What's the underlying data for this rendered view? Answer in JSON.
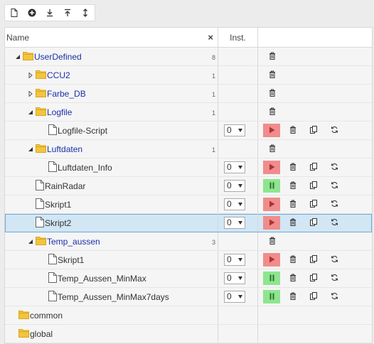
{
  "toolbar": {
    "buttons": [
      {
        "icon": "new-script-icon"
      },
      {
        "icon": "add-folder-icon"
      },
      {
        "icon": "import-icon"
      },
      {
        "icon": "export-icon"
      },
      {
        "icon": "sort-icon"
      }
    ]
  },
  "table": {
    "header_name": "Name",
    "header_clear": "×",
    "header_instance": "Inst."
  },
  "rows": [
    {
      "name": "UserDefined",
      "count": "8",
      "type": "folder",
      "level": 0,
      "expand": "expanded",
      "actions": "folder"
    },
    {
      "name": "CCU2",
      "count": "1",
      "type": "folder",
      "level": 1,
      "expand": "collapsed",
      "actions": "folder"
    },
    {
      "name": "Farbe_DB",
      "count": "1",
      "type": "folder",
      "level": 1,
      "expand": "collapsed",
      "actions": "folder"
    },
    {
      "name": "Logfile",
      "count": "1",
      "type": "folder",
      "level": 1,
      "expand": "expanded",
      "actions": "folder"
    },
    {
      "name": "Logfile-Script",
      "type": "script",
      "level": 2,
      "instance": "0",
      "state": "stopped",
      "actions": "script"
    },
    {
      "name": "Luftdaten",
      "count": "1",
      "type": "folder",
      "level": 1,
      "expand": "expanded",
      "actions": "folder"
    },
    {
      "name": "Luftdaten_Info",
      "type": "script",
      "level": 2,
      "instance": "0",
      "state": "stopped",
      "actions": "script"
    },
    {
      "name": "RainRadar",
      "type": "script",
      "level": 1,
      "instance": "0",
      "state": "running",
      "actions": "script"
    },
    {
      "name": "Skript1",
      "type": "script",
      "level": 1,
      "instance": "0",
      "state": "stopped",
      "actions": "script"
    },
    {
      "name": "Skript2",
      "type": "script",
      "level": 1,
      "instance": "0",
      "state": "stopped",
      "actions": "script",
      "selected": true
    },
    {
      "name": "Temp_aussen",
      "count": "3",
      "type": "folder",
      "level": 1,
      "expand": "expanded",
      "actions": "folder"
    },
    {
      "name": "Skript1",
      "type": "script",
      "level": 2,
      "instance": "0",
      "state": "stopped",
      "actions": "script"
    },
    {
      "name": "Temp_Aussen_MinMax",
      "type": "script",
      "level": 2,
      "instance": "0",
      "state": "running",
      "actions": "script"
    },
    {
      "name": "Temp_Aussen_MinMax7days",
      "type": "script",
      "level": 2,
      "instance": "0",
      "state": "running",
      "actions": "script"
    },
    {
      "name": "common",
      "type": "folder",
      "level": 0,
      "expand": "none",
      "actions": "none"
    },
    {
      "name": "global",
      "type": "folder",
      "level": 0,
      "expand": "none",
      "actions": "none"
    }
  ],
  "colors": {
    "folder_name": "#1a30a8",
    "play_button": "#f08c8c",
    "pause_button": "#8fe58f",
    "selected_row": "#d2e6f4"
  }
}
